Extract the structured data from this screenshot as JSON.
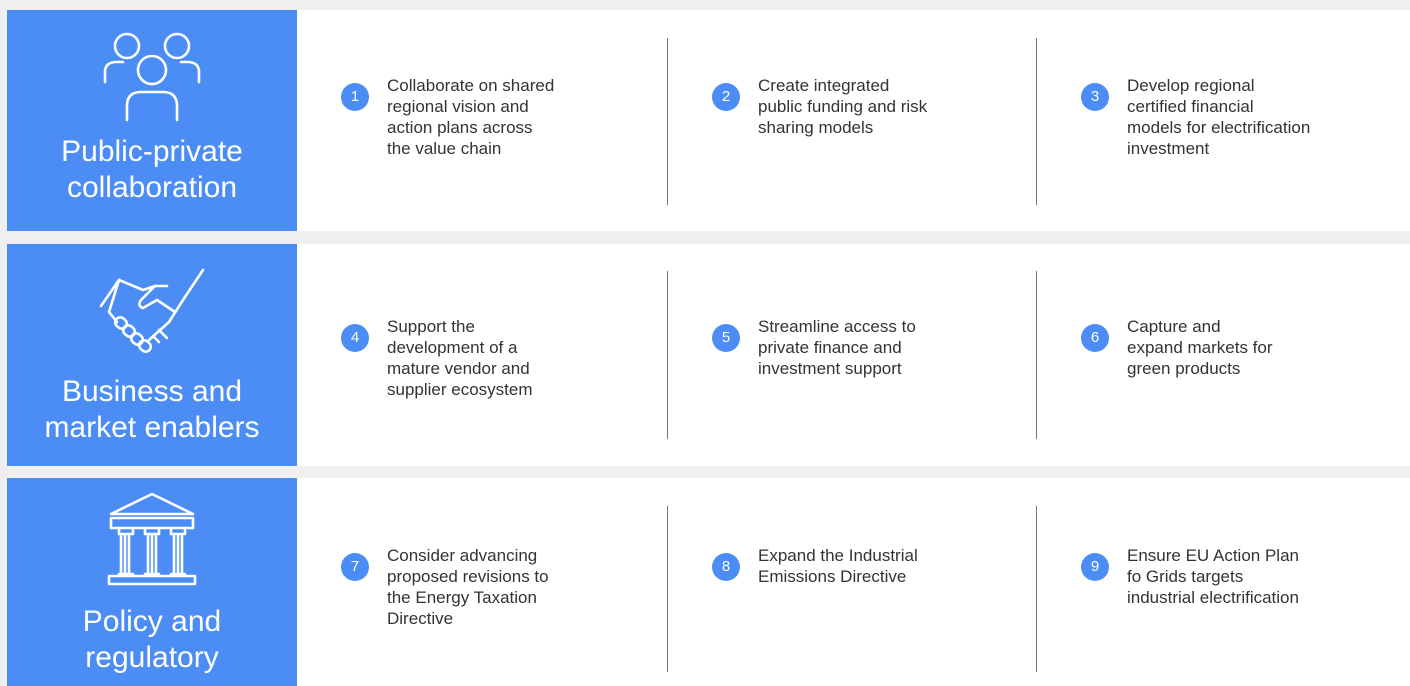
{
  "rows": [
    {
      "category": {
        "icon": "people-group-icon",
        "label_lines": [
          "Public-private",
          "collaboration"
        ]
      },
      "items": [
        {
          "number": "1",
          "lines": [
            "Collaborate on shared",
            "regional vision and",
            "action plans across",
            "the value chain"
          ]
        },
        {
          "number": "2",
          "lines": [
            "Create integrated",
            "public funding and risk",
            "sharing models"
          ]
        },
        {
          "number": "3",
          "lines": [
            "Develop regional",
            "certified financial",
            "models for electrification",
            "investment"
          ]
        }
      ]
    },
    {
      "category": {
        "icon": "handshake-icon",
        "label_lines": [
          "Business and",
          "market enablers"
        ]
      },
      "items": [
        {
          "number": "4",
          "lines": [
            "Support the",
            "development of a",
            "mature vendor and",
            "supplier ecosystem"
          ]
        },
        {
          "number": "5",
          "lines": [
            "Streamline access to",
            "private finance and",
            "investment support"
          ]
        },
        {
          "number": "6",
          "lines": [
            "Capture and",
            "expand markets for",
            "green products"
          ]
        }
      ]
    },
    {
      "category": {
        "icon": "government-building-icon",
        "label_lines": [
          "Policy and",
          "regulatory"
        ]
      },
      "items": [
        {
          "number": "7",
          "lines": [
            "Consider advancing",
            "proposed revisions to",
            "the Energy Taxation",
            "Directive"
          ]
        },
        {
          "number": "8",
          "lines": [
            "Expand the Industrial",
            "Emissions Directive"
          ]
        },
        {
          "number": "9",
          "lines": [
            "Ensure EU Action Plan",
            "fo Grids targets",
            "industrial electrification"
          ]
        }
      ]
    }
  ],
  "colors": {
    "accent": "#4b8df5",
    "background": "#efefef",
    "panel": "#ffffff",
    "text": "#333333"
  }
}
